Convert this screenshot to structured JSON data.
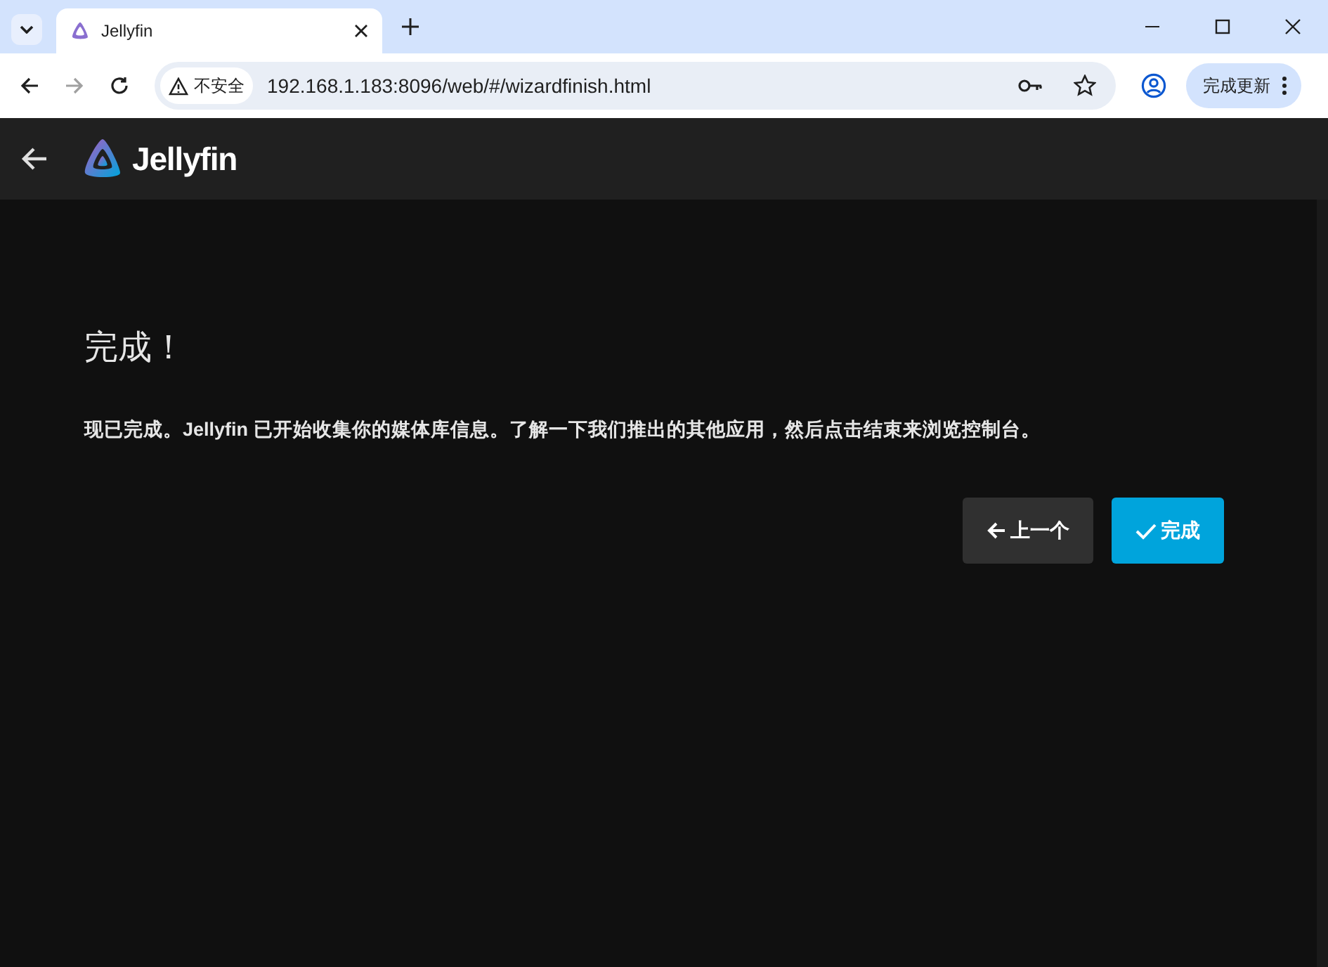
{
  "browser": {
    "tabs": [
      {
        "title": "Jellyfin",
        "selected": true
      }
    ],
    "address": {
      "security_label": "不安全",
      "url": "192.168.1.183:8096/web/#/wizardfinish.html"
    },
    "update_button": "完成更新"
  },
  "app_header": {
    "logo_text": "Jellyfin"
  },
  "page": {
    "title": "完成！",
    "description": "现已完成。Jellyfin 已开始收集你的媒体库信息。了解一下我们推出的其他应用，然后点击结束来浏览控制台。",
    "buttons": [
      {
        "label": "上一个",
        "kind": "back"
      },
      {
        "label": "完成",
        "kind": "finish"
      }
    ]
  }
}
